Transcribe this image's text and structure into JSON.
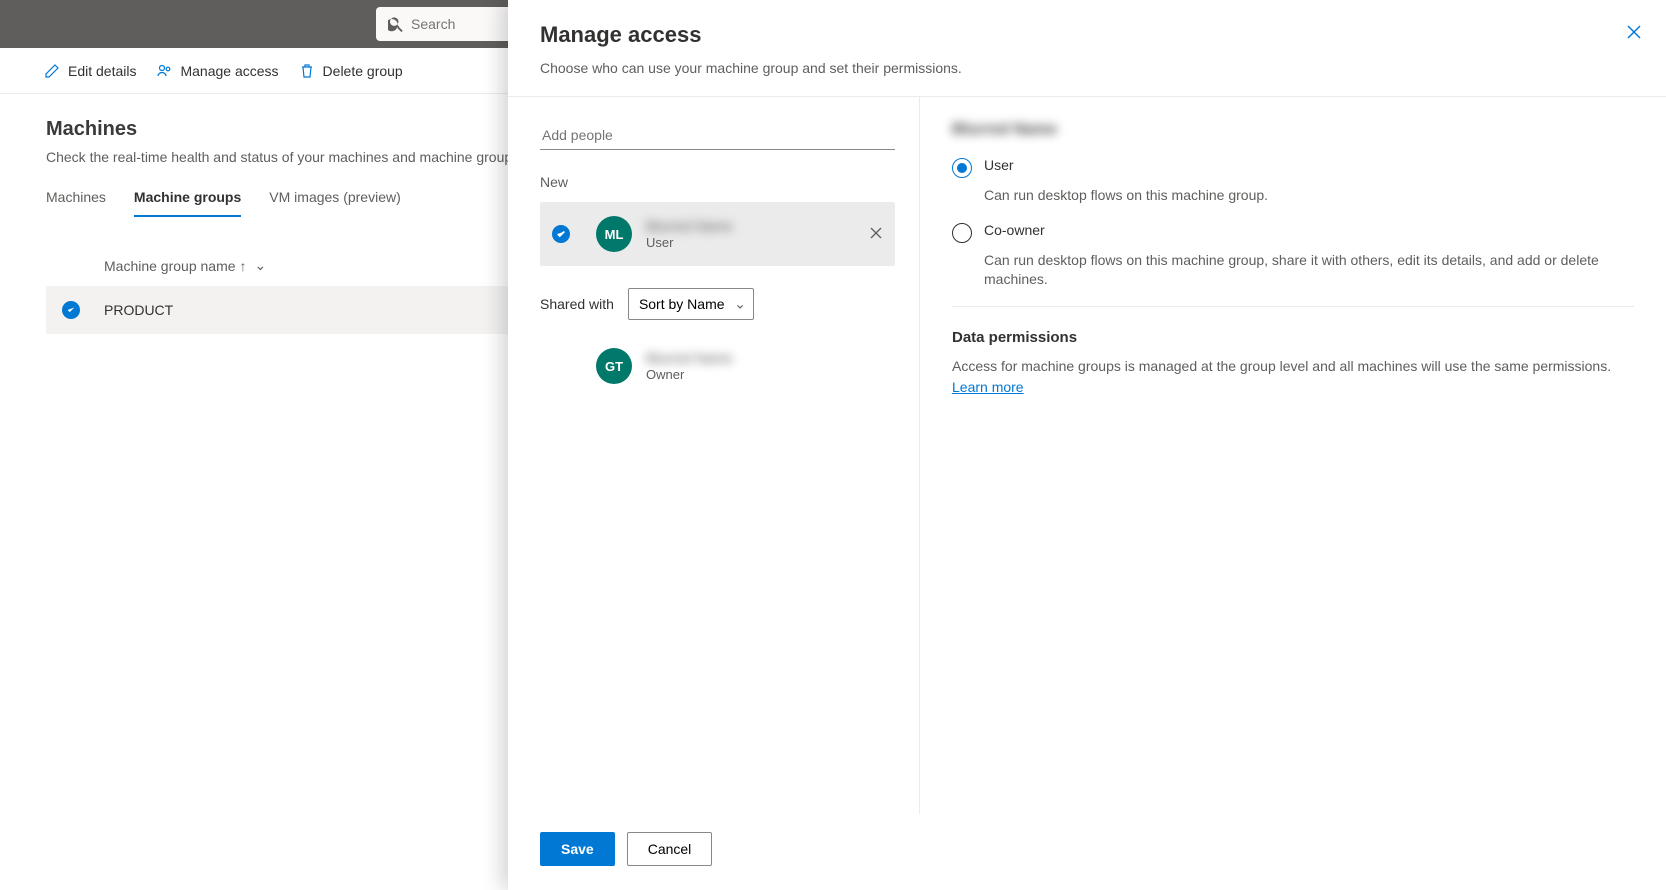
{
  "search": {
    "placeholder": "Search"
  },
  "commandBar": {
    "edit": "Edit details",
    "manage": "Manage access",
    "delete": "Delete group"
  },
  "page": {
    "title": "Machines",
    "subtitle": "Check the real-time health and status of your machines and machine groups."
  },
  "tabs": {
    "machines": "Machines",
    "groups": "Machine groups",
    "vm": "VM images (preview)"
  },
  "table": {
    "headerName": "Machine group name",
    "row1": "PRODUCT"
  },
  "panel": {
    "title": "Manage access",
    "subtitle": "Choose who can use your machine group and set their permissions.",
    "addPeople": "Add people",
    "newLabel": "New",
    "sharedWithLabel": "Shared with",
    "sortBy": "Sort by Name",
    "people": {
      "new": {
        "initials": "ML",
        "name": "Blurred Name",
        "role": "User"
      },
      "owner": {
        "initials": "GT",
        "name": "Blurred Name",
        "role": "Owner"
      }
    },
    "permissions": {
      "heading": "Blurred Name",
      "user": {
        "label": "User",
        "desc": "Can run desktop flows on this machine group."
      },
      "coowner": {
        "label": "Co-owner",
        "desc": "Can run desktop flows on this machine group, share it with others, edit its details, and add or delete machines."
      }
    },
    "dataPerm": {
      "title": "Data permissions",
      "text": "Access for machine groups is managed at the group level and all machines will use the same permissions. ",
      "link": "Learn more"
    },
    "footer": {
      "save": "Save",
      "cancel": "Cancel"
    }
  }
}
